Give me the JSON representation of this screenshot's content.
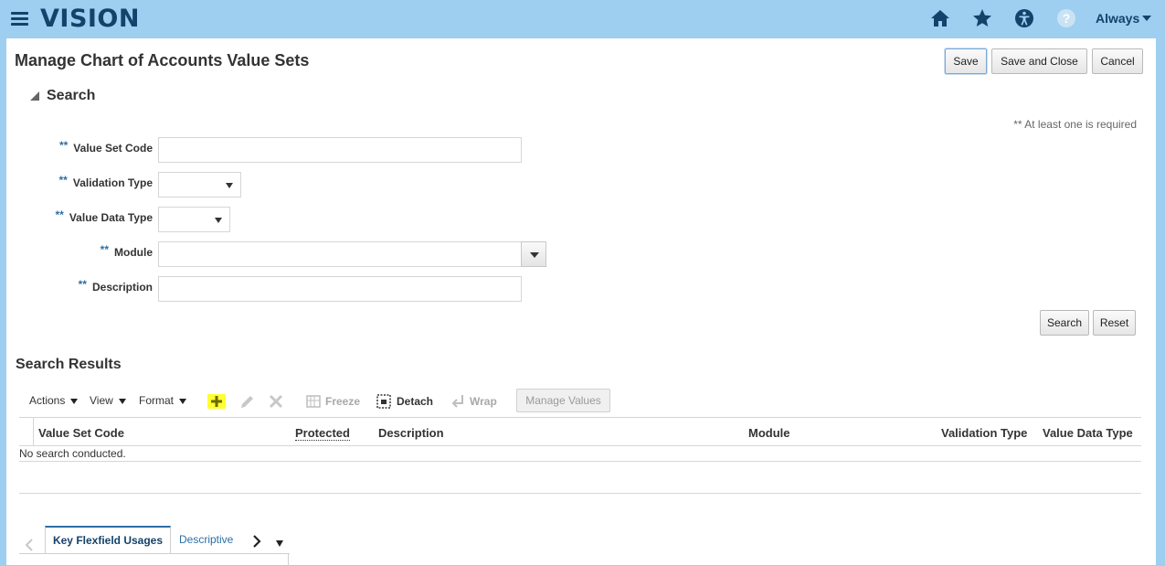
{
  "header": {
    "brand": "VISION",
    "user_menu": "Always",
    "icons": [
      "menu-icon",
      "home-icon",
      "star-icon",
      "accessibility-icon",
      "help-icon"
    ]
  },
  "page": {
    "title": "Manage Chart of Accounts Value Sets",
    "buttons": {
      "save": "Save",
      "save_close": "Save and Close",
      "cancel": "Cancel"
    }
  },
  "search": {
    "heading": "Search",
    "required_note": "** At least one is required",
    "required_marker": "**",
    "fields": {
      "value_set_code": {
        "label": "Value Set Code",
        "value": ""
      },
      "validation_type": {
        "label": "Validation Type",
        "value": ""
      },
      "value_data_type": {
        "label": "Value Data Type",
        "value": ""
      },
      "module": {
        "label": "Module",
        "value": ""
      },
      "description": {
        "label": "Description",
        "value": ""
      }
    },
    "buttons": {
      "search": "Search",
      "reset": "Reset"
    }
  },
  "results": {
    "heading": "Search Results",
    "toolbar": {
      "actions": "Actions",
      "view": "View",
      "format": "Format",
      "freeze": "Freeze",
      "detach": "Detach",
      "wrap": "Wrap",
      "manage_values": "Manage Values"
    },
    "columns": [
      "Value Set Code",
      "Protected",
      "Description",
      "Module",
      "Validation Type",
      "Value Data Type"
    ],
    "empty_message": "No search conducted.",
    "highlight_color": "#ffff33"
  },
  "tabs": {
    "items": [
      "Key Flexfield Usages",
      "Descriptive"
    ],
    "active_index": 0
  },
  "colors": {
    "header_bg": "#9ecff0",
    "brand": "#14426b",
    "accent": "#2e6ea6"
  }
}
